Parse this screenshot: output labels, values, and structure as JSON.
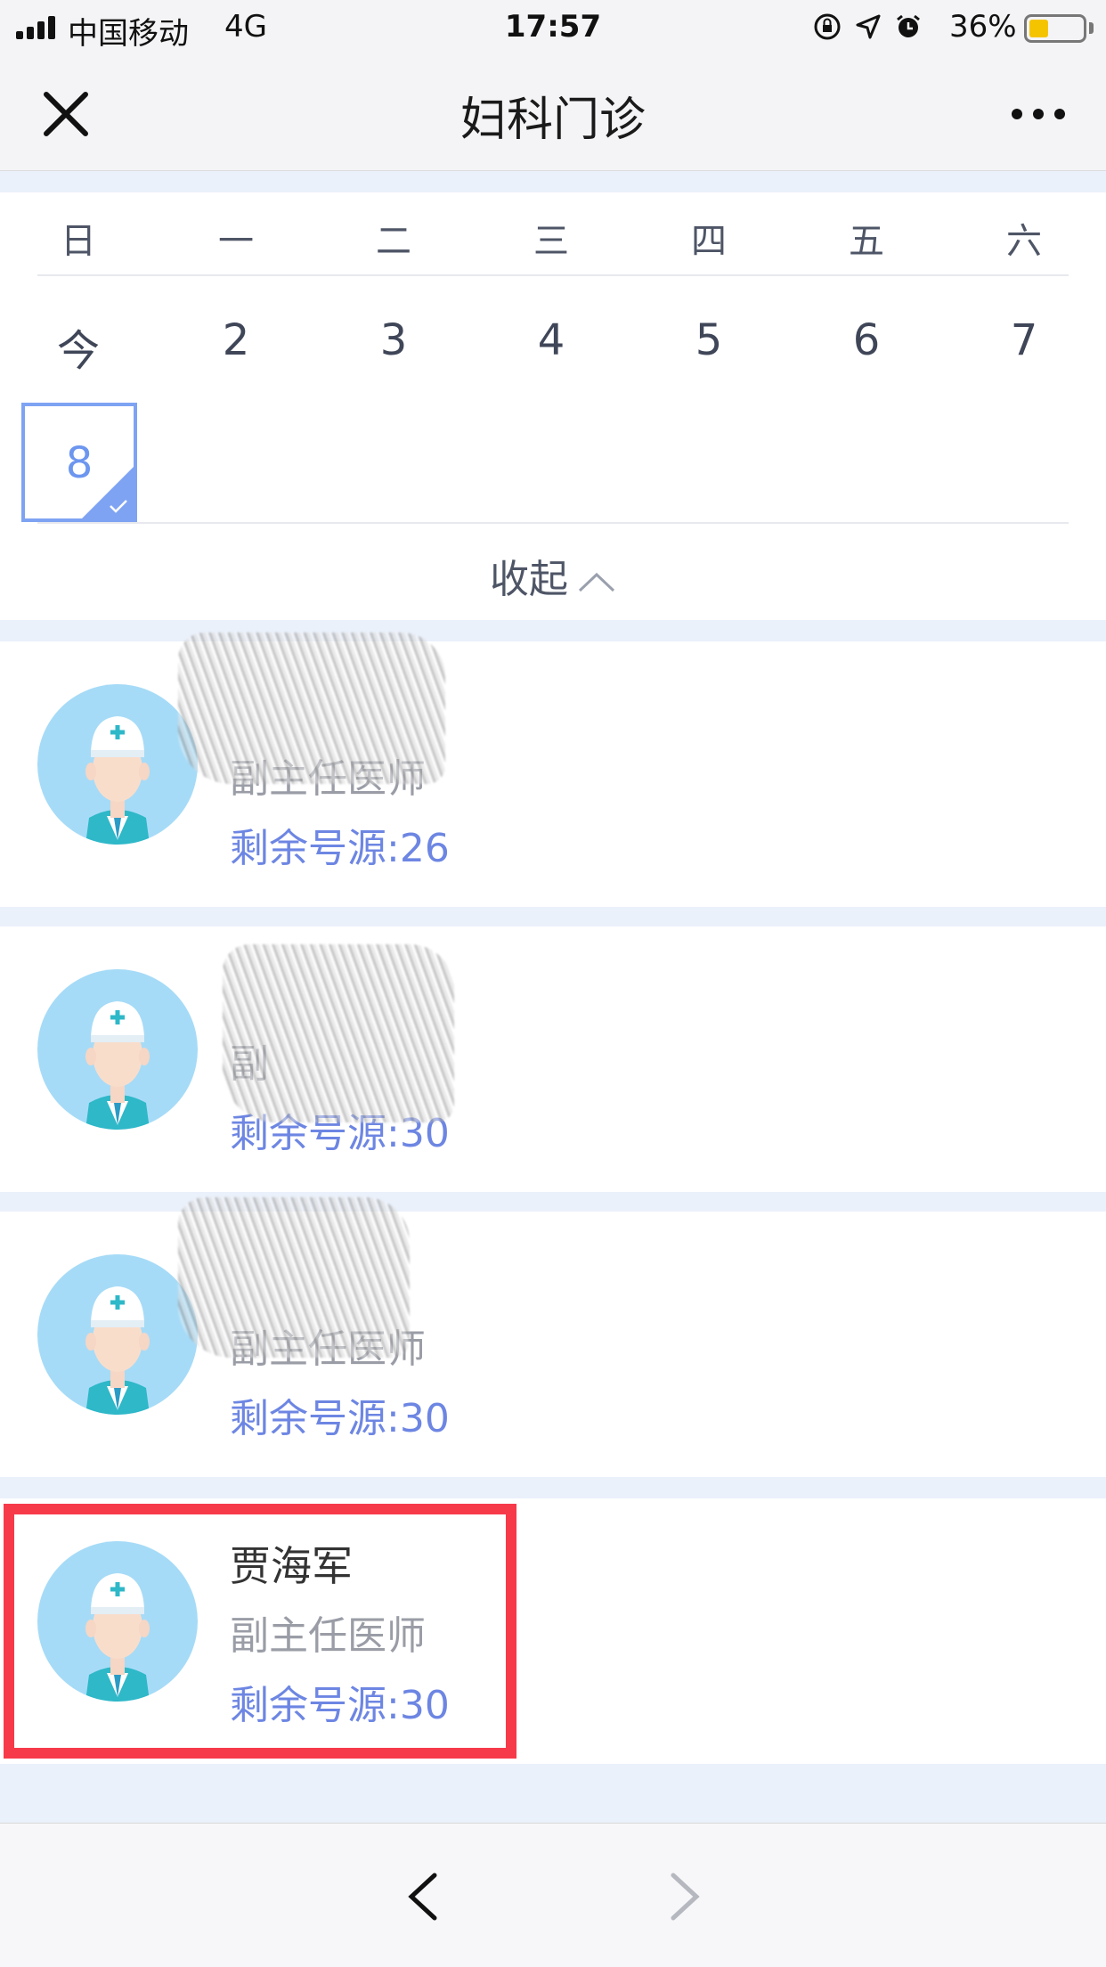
{
  "status_bar": {
    "carrier": "中国移动",
    "network": "4G",
    "time": "17:57",
    "battery_percent_label": "36%",
    "battery_level": 0.36,
    "icons": [
      "orientation-lock-icon",
      "location-arrow-icon",
      "alarm-icon"
    ]
  },
  "nav": {
    "title": "妇科门诊",
    "close_icon": "close-icon",
    "more_icon": "more-icon"
  },
  "calendar": {
    "weekdays": [
      "日",
      "一",
      "二",
      "三",
      "四",
      "五",
      "六"
    ],
    "dates": [
      "今",
      "2",
      "3",
      "4",
      "5",
      "6",
      "7"
    ],
    "selected_date": "8",
    "collapse_label": "收起"
  },
  "doctors": [
    {
      "name": "",
      "title": "副主任医师",
      "remaining": "剩余号源:26",
      "name_redacted": true
    },
    {
      "name": "",
      "title": "副",
      "remaining": "剩余号源:30",
      "name_redacted": true
    },
    {
      "name": "",
      "title": "副主任医师",
      "remaining": "剩余号源:30",
      "name_redacted": true
    },
    {
      "name": "贾海军",
      "title": "副主任医师",
      "remaining": "剩余号源:30",
      "name_redacted": false
    }
  ],
  "colors": {
    "accent_blue": "#6d86e3",
    "selected_border": "#7ea3f3",
    "highlight_red": "#f73a4a",
    "avatar_bg": "#a6dbf7"
  },
  "bottom_bar": {
    "back_icon": "chevron-left-icon",
    "forward_icon": "chevron-right-icon"
  }
}
